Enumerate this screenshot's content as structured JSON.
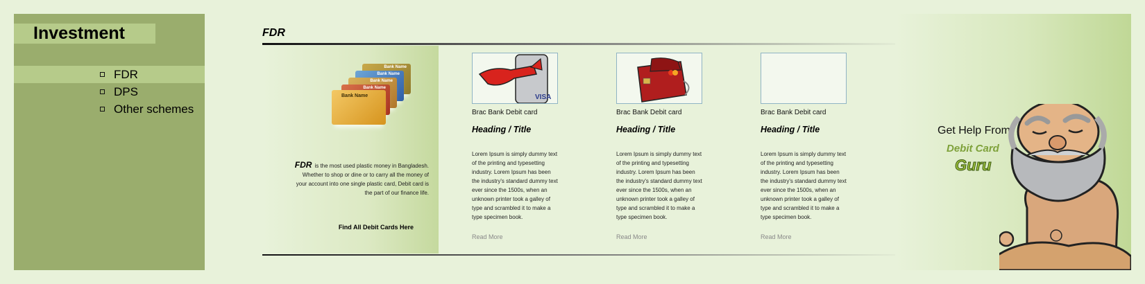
{
  "sidebar": {
    "title": "Investment",
    "items": [
      {
        "label": "FDR",
        "active": true
      },
      {
        "label": "DPS",
        "active": false
      },
      {
        "label": "Other schemes",
        "active": false
      }
    ]
  },
  "main": {
    "section_title": "FDR",
    "intro": {
      "lead": "FDR",
      "text": "is the most used plastic money in Bangladesh. Whether to shop or dine or to carry all the money of your account into one single plastic card, Debit card is the part of our finance life.",
      "link": "Find All Debit Cards Here",
      "card_label": "Bank Name"
    },
    "products": [
      {
        "name": "Brac Bank Debit card",
        "heading": "Heading / Title",
        "desc": "Lorem Ipsum is simply dummy text of the printing and typesetting industry. Lorem Ipsum has been the industry's standard dummy text ever since the 1500s, when an unknown printer took a galley of type and scrambled it to make a type specimen book.",
        "read_more": "Read More",
        "image": "card-with-scarf-illustration"
      },
      {
        "name": "Brac Bank Debit card",
        "heading": "Heading / Title",
        "desc": "Lorem Ipsum is simply dummy text of the printing and typesetting industry. Lorem Ipsum has been the industry's standard dummy text ever since the 1500s, when an unknown printer took a galley of type and scrambled it to make a type specimen book.",
        "read_more": "Read More",
        "image": "red-wallet-card-illustration"
      },
      {
        "name": "Brac Bank Debit card",
        "heading": "Heading / Title",
        "desc": "Lorem Ipsum is simply dummy text of the printing and typesetting industry. Lorem Ipsum has been the industry's standard dummy text ever since the 1500s, when an unknown printer took a galley of type and scrambled it to make a type specimen book.",
        "read_more": "Read More",
        "image": "empty"
      }
    ]
  },
  "help": {
    "title": "Get Help From",
    "sub1": "Debit Card",
    "sub2": "Guru"
  },
  "colors": {
    "background": "#e8f2da",
    "sidebar": "#9aad6d",
    "sidebar_highlight": "#b6cb8a",
    "accent_green": "#7ea13a"
  }
}
